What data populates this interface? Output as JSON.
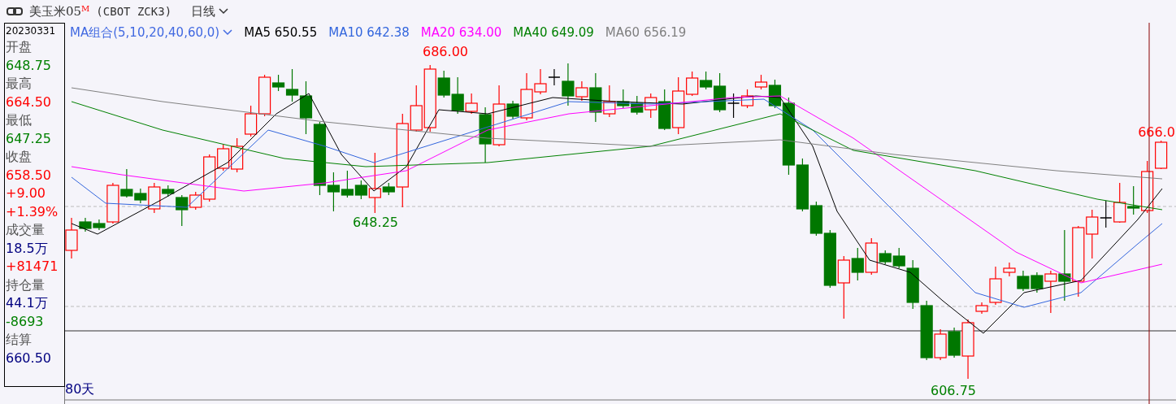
{
  "header": {
    "title": "美玉米05$^{M}$",
    "code": "(CBOT ZCK3)",
    "period": "日线"
  },
  "info_panel": {
    "date": "20230331",
    "items": [
      {
        "text": "开盘",
        "color": "#555555"
      },
      {
        "text": "648.75",
        "color": "#008000"
      },
      {
        "text": "最高",
        "color": "#555555"
      },
      {
        "text": "664.50",
        "color": "#ff0000"
      },
      {
        "text": "最低",
        "color": "#555555"
      },
      {
        "text": "647.25",
        "color": "#008000"
      },
      {
        "text": "收盘",
        "color": "#555555"
      },
      {
        "text": "658.50",
        "color": "#ff0000"
      },
      {
        "text": "+9.00",
        "color": "#ff0000"
      },
      {
        "text": "+1.39%",
        "color": "#ff0000"
      },
      {
        "text": "成交量",
        "color": "#555555"
      },
      {
        "text": "18.5万",
        "color": "#000080"
      },
      {
        "text": "+81471",
        "color": "#ff0000"
      },
      {
        "text": "持仓量",
        "color": "#555555"
      },
      {
        "text": "44.1万",
        "color": "#000080"
      },
      {
        "text": "-8693",
        "color": "#008000"
      },
      {
        "text": "结算",
        "color": "#555555"
      },
      {
        "text": "660.50",
        "color": "#000080"
      }
    ]
  },
  "chart": {
    "indicator": "MA组合(5,10,20,40,60,0)",
    "moving_averages": [
      {
        "name": "MA5",
        "value": "650.55",
        "color": "#000000"
      },
      {
        "name": "MA10",
        "value": "642.38",
        "color": "#3366dd"
      },
      {
        "name": "MA20",
        "value": "634.00",
        "color": "#ff00ff"
      },
      {
        "name": "MA40",
        "value": "649.09",
        "color": "#008000"
      },
      {
        "name": "MA60",
        "value": "656.19",
        "color": "#808080"
      }
    ],
    "price_labels": [
      {
        "text": "686.00",
        "color": "#ff0000"
      },
      {
        "text": "648.25",
        "color": "#008000"
      },
      {
        "text": "606.75",
        "color": "#008000"
      },
      {
        "text": "666.0",
        "color": "#ff0000"
      }
    ],
    "period_count": "80天"
  }
}
